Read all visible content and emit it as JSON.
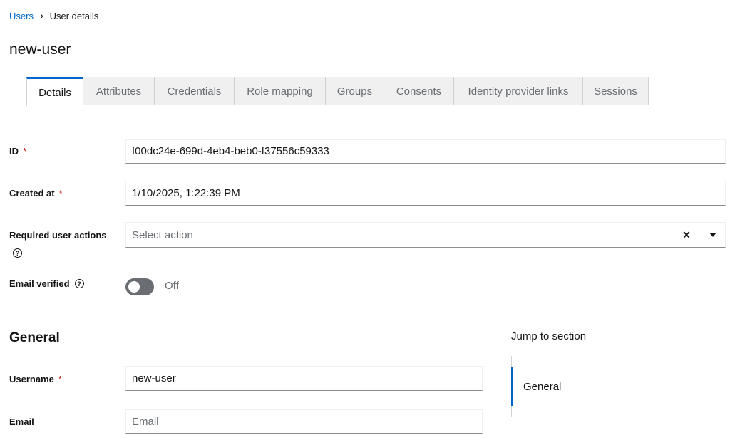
{
  "breadcrumb": {
    "root": "Users",
    "separator": "›",
    "current": "User details"
  },
  "page_title": "new-user",
  "tabs": [
    {
      "label": "Details",
      "active": true
    },
    {
      "label": "Attributes"
    },
    {
      "label": "Credentials"
    },
    {
      "label": "Role mapping"
    },
    {
      "label": "Groups"
    },
    {
      "label": "Consents"
    },
    {
      "label": "Identity provider links"
    },
    {
      "label": "Sessions"
    }
  ],
  "form": {
    "id": {
      "label": "ID",
      "required": "*",
      "value": "f00dc24e-699d-4eb4-beb0-f37556c59333"
    },
    "created_at": {
      "label": "Created at",
      "required": "*",
      "value": "1/10/2025, 1:22:39 PM"
    },
    "required_actions": {
      "label": "Required user actions",
      "placeholder": "Select action",
      "clear": "✕",
      "help_icon": "question-circle-icon"
    },
    "email_verified": {
      "label": "Email verified",
      "state": "Off",
      "enabled": false,
      "help_icon": "question-circle-icon"
    }
  },
  "general": {
    "title": "General",
    "username": {
      "label": "Username",
      "required": "*",
      "value": "new-user"
    },
    "email": {
      "label": "Email",
      "placeholder": "Email"
    }
  },
  "jump": {
    "title": "Jump to section",
    "items": [
      "General"
    ]
  },
  "colors": {
    "accent": "#0066cc",
    "required": "#c9190b",
    "toggle_off": "#6a6e73"
  }
}
